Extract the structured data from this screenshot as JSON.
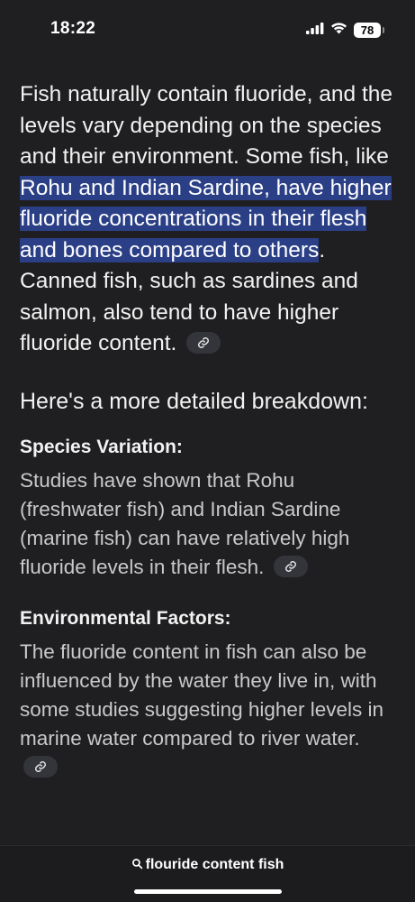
{
  "status_bar": {
    "time": "18:22",
    "battery": "78",
    "icons": [
      "signal-icon",
      "wifi-icon",
      "battery-icon"
    ]
  },
  "answer": {
    "lead_before": "Fish naturally contain fluoride, and the levels vary depending on the species and their environment. Some fish, like ",
    "lead_highlight": "Rohu and Indian Sardine, have higher fluoride concentrations in their flesh and bones compared to others",
    "lead_after": ". Canned fish, such as sardines and salmon, also tend to have higher fluoride content.",
    "subheading": "Here's a more detailed breakdown:",
    "sections": [
      {
        "title": "Species Variation:",
        "body": "Studies have shown that Rohu (freshwater fish) and Indian Sardine (marine fish) can have relatively high fluoride levels in their flesh."
      },
      {
        "title": "Environmental Factors:",
        "body": "The fluoride content in fish can also be influenced by the water they live in, with some studies suggesting higher levels in marine water compared to river water."
      }
    ]
  },
  "bottom_bar": {
    "query": "flouride content fish"
  },
  "colors": {
    "background": "#1f1f21",
    "highlight": "#2b3f86",
    "chip": "#33353a"
  }
}
